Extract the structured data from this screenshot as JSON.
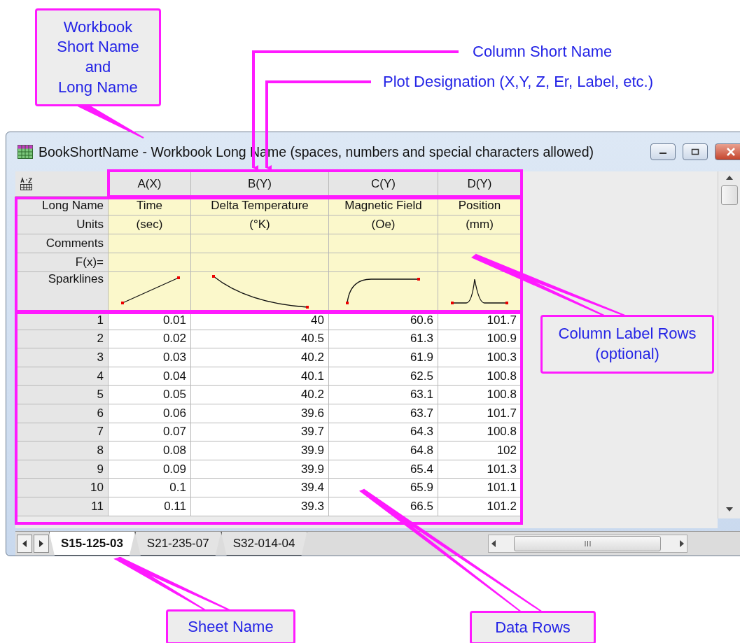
{
  "window": {
    "title": "BookShortName - Workbook Long Name (spaces, numbers and special characters allowed)"
  },
  "columns": [
    {
      "short_name": "A(X)",
      "long_name": "Time",
      "units": "(sec)"
    },
    {
      "short_name": "B(Y)",
      "long_name": "Delta Temperature",
      "units": "(°K)"
    },
    {
      "short_name": "C(Y)",
      "long_name": "Magnetic Field",
      "units": "(Oe)"
    },
    {
      "short_name": "D(Y)",
      "long_name": "Position",
      "units": "(mm)"
    }
  ],
  "label_rows": [
    {
      "label": "Long Name",
      "kind": "long_name"
    },
    {
      "label": "Units",
      "kind": "units"
    },
    {
      "label": "Comments",
      "kind": "empty"
    },
    {
      "label": "F(x)=",
      "kind": "empty"
    },
    {
      "label": "Sparklines",
      "kind": "sparkline"
    }
  ],
  "rows": [
    [
      "1",
      "0.01",
      "40",
      "60.6",
      "101.7"
    ],
    [
      "2",
      "0.02",
      "40.5",
      "61.3",
      "100.9"
    ],
    [
      "3",
      "0.03",
      "40.2",
      "61.9",
      "100.3"
    ],
    [
      "4",
      "0.04",
      "40.1",
      "62.5",
      "100.8"
    ],
    [
      "5",
      "0.05",
      "40.2",
      "63.1",
      "100.8"
    ],
    [
      "6",
      "0.06",
      "39.6",
      "63.7",
      "101.7"
    ],
    [
      "7",
      "0.07",
      "39.7",
      "64.3",
      "100.8"
    ],
    [
      "8",
      "0.08",
      "39.9",
      "64.8",
      "102"
    ],
    [
      "9",
      "0.09",
      "39.9",
      "65.4",
      "101.3"
    ],
    [
      "10",
      "0.1",
      "39.4",
      "65.9",
      "101.1"
    ],
    [
      "11",
      "0.11",
      "39.3",
      "66.5",
      "101.2"
    ]
  ],
  "sheet_tabs": [
    {
      "label": "S15-125-03",
      "selected": true
    },
    {
      "label": "S21-235-07",
      "selected": false
    },
    {
      "label": "S32-014-04",
      "selected": false
    }
  ],
  "callouts": [
    {
      "kind": "box",
      "lines": [
        "Workbook",
        "Short Name",
        "and",
        "Long Name"
      ]
    },
    {
      "kind": "plain",
      "lines": [
        "Column Short Name"
      ]
    },
    {
      "kind": "plain",
      "lines": [
        "Plot Designation (X,Y, Z, Er, Label, etc.)"
      ]
    },
    {
      "kind": "box",
      "lines": [
        "Column Label Rows",
        "(optional)"
      ]
    },
    {
      "kind": "box",
      "lines": [
        "Sheet Name"
      ]
    },
    {
      "kind": "box",
      "lines": [
        "Data Rows"
      ]
    }
  ]
}
